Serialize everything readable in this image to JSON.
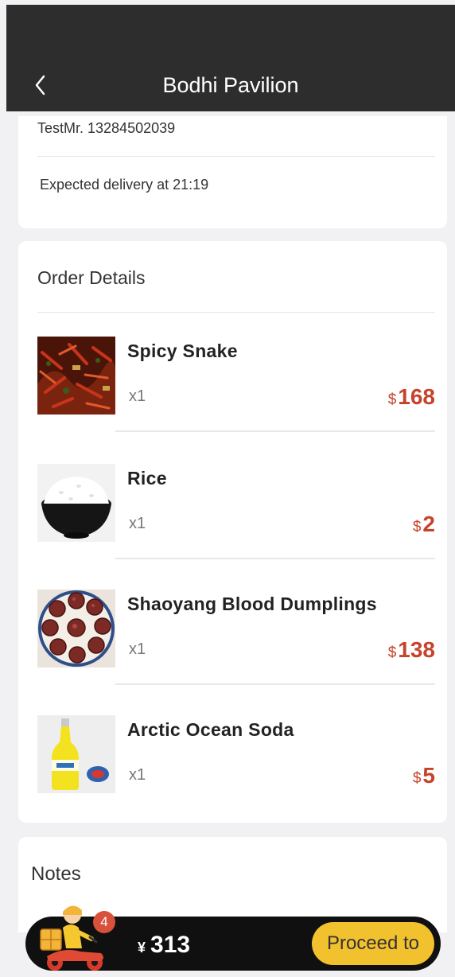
{
  "header": {
    "title": "Bodhi Pavilion",
    "back_icon": "chevron-left-icon"
  },
  "delivery": {
    "contact": "TestMr.  13284502039",
    "expected": "Expected delivery at 21:19"
  },
  "order": {
    "title": "Order Details",
    "currency": "$",
    "items": [
      {
        "name": "Spicy Snake",
        "qty": "x1",
        "price": "168",
        "image": "spicy-snake-photo"
      },
      {
        "name": "Rice",
        "qty": "x1",
        "price": "2",
        "image": "rice-bowl-photo"
      },
      {
        "name": "Shaoyang Blood Dumplings",
        "qty": "x1",
        "price": "138",
        "image": "blood-dumplings-photo"
      },
      {
        "name": "Arctic Ocean Soda",
        "qty": "x1",
        "price": "5",
        "image": "soda-bottle-photo"
      }
    ]
  },
  "notes": {
    "title": "Notes"
  },
  "cart": {
    "badge_count": "4",
    "currency": "¥",
    "total": "313",
    "proceed_label": "Proceed to",
    "icon": "delivery-courier-icon"
  },
  "colors": {
    "header_bg": "#2d2d2d",
    "price": "#c6432b",
    "accent": "#f2c12e",
    "badge": "#d7513b"
  }
}
